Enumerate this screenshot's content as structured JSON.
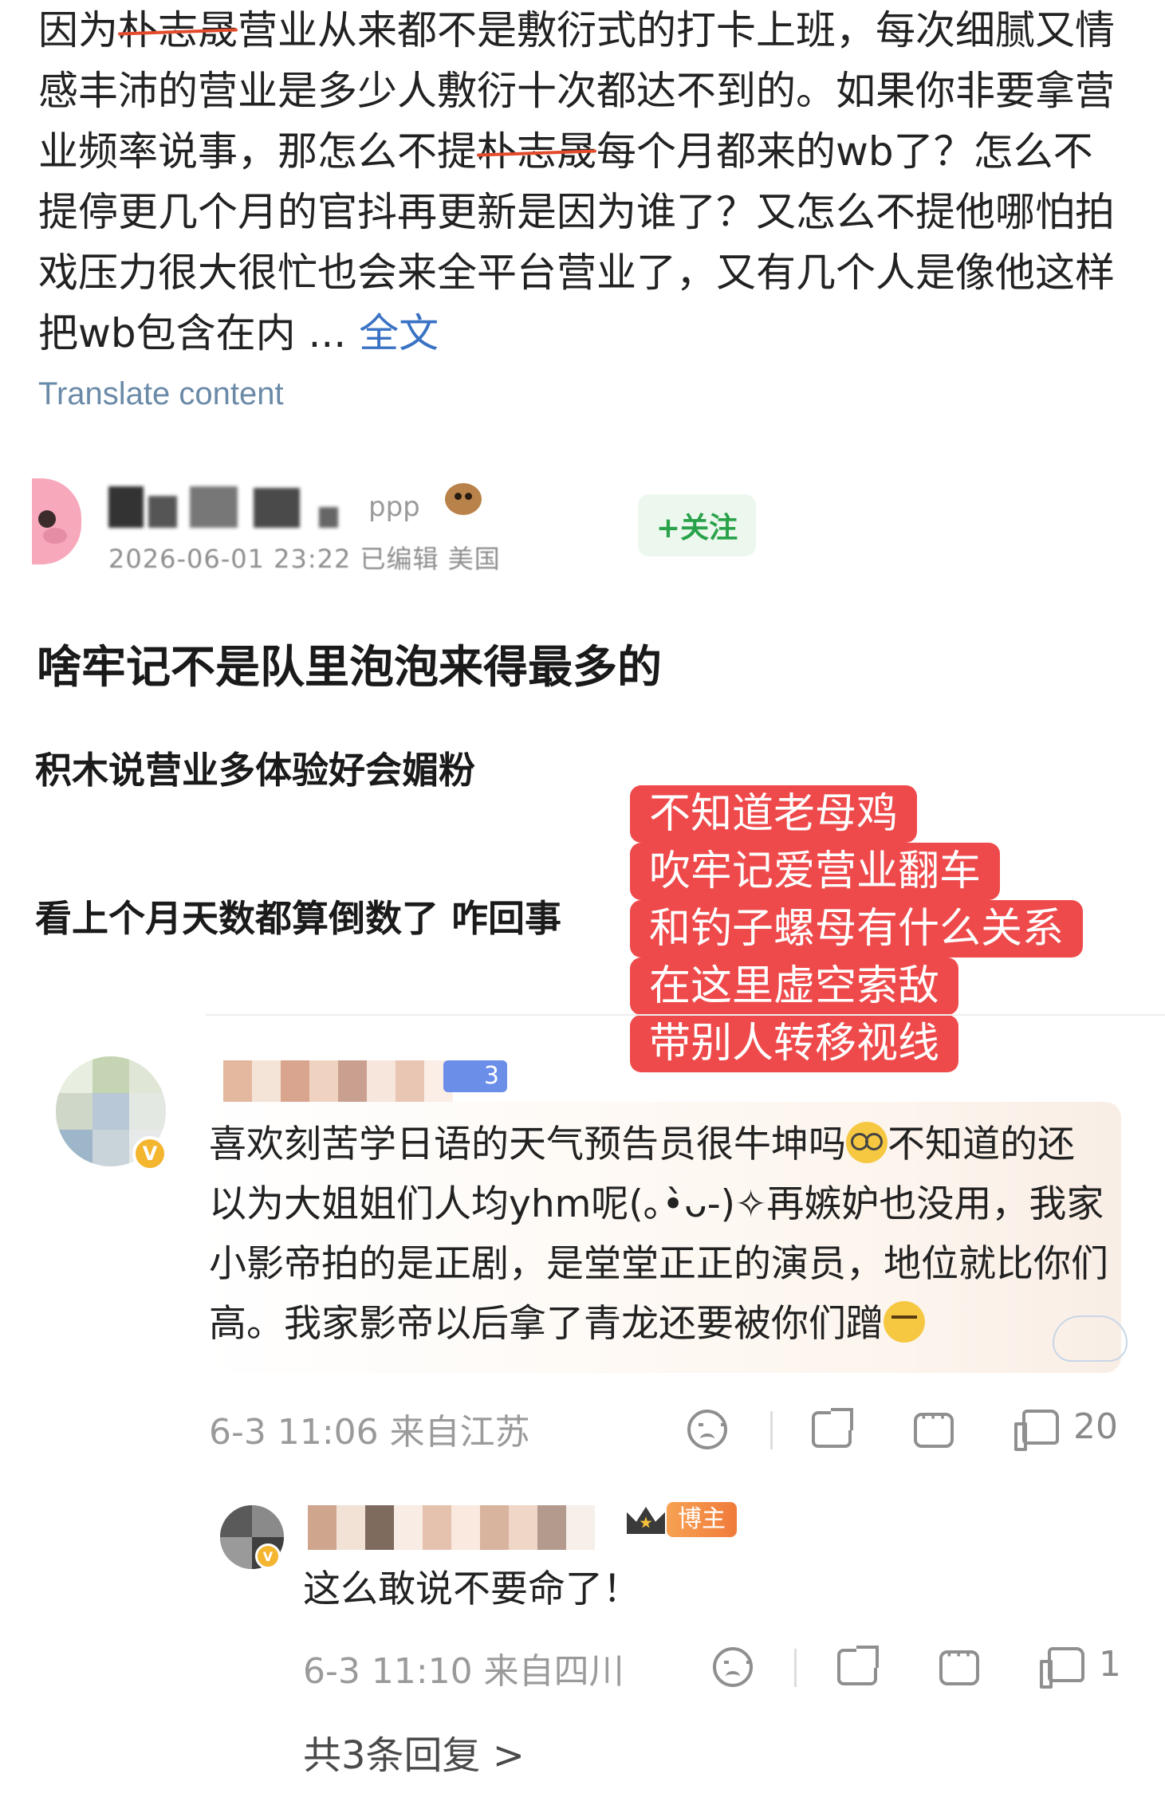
{
  "post": {
    "seg1": "因为",
    "name1": "朴志晟",
    "seg2": "营业从来都不是敷衍式的打卡上班，每次细腻又情感丰沛的营业是多少人敷衍十次都达不到的。如果你非要拿营业频率说事，那怎么不提",
    "name2": "朴志晟",
    "seg3": "每个月都来的wb了？怎么不提停更几个月的官抖再更新是因为谁了？又怎么不提他哪怕拍戏压力很大很忙也会来全平台营业了，又有几个人是像他这样把wb包含在内 ... ",
    "full_text_link": "全文",
    "translate_label": "Translate content"
  },
  "embedded": {
    "name_suffix": "ppp",
    "meta": "2026-06-01 23:22 已编辑 美国",
    "follow_label": "+关注",
    "line1": "啥牢记不是队里泡泡来得最多的",
    "line2": "积木说营业多体验好会媚粉",
    "line3": "看上个月天数都算倒数了 咋回事"
  },
  "caption": {
    "rows": [
      "不知道老母鸡",
      "吹牢记爱营业翻车",
      "和钓子螺母有什么关系",
      "在这里虚空索敌",
      "带别人转移视线"
    ]
  },
  "comment1": {
    "level": "3",
    "text_a": "喜欢刻苦学日语的天气预告员很牛坤吗",
    "text_b": "不知道的还以为大姐姐们人均yhm呢(｡•̀ᴗ-)✧再嫉妒也没用，我家小影帝拍的是正剧，是堂堂正正的演员，地位就比你们高。我家影帝以后拿了青龙还要被你们蹭",
    "time": "6-3 11:06",
    "location": "来自江苏",
    "likes": "20"
  },
  "comment2": {
    "author_tag": "博主",
    "text": "这么敢说不要命了！",
    "time": "6-3 11:10",
    "location": "来自四川",
    "likes": "1"
  },
  "replies_link": "共3条回复 >",
  "colors": {
    "strike": "#e34b2c",
    "link": "#3a72c4",
    "caption_bg": "#ef4a4b",
    "follow_green": "#2aa24a",
    "verified": "#f4b52f",
    "author_tag": "#f07a3a"
  }
}
